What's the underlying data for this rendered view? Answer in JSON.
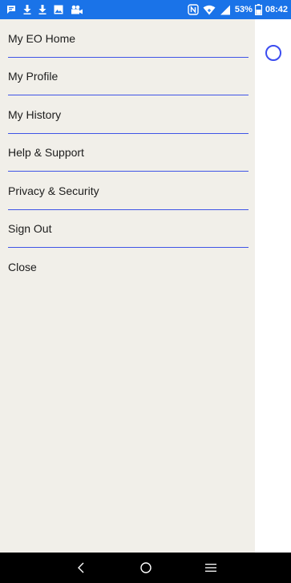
{
  "status_bar": {
    "left_icons": [
      "message-icon",
      "download-icon",
      "download-icon",
      "image-icon",
      "video-call-icon"
    ],
    "right_icons": [
      "nfc-icon",
      "wifi-icon",
      "signal-icon"
    ],
    "battery_percent": "53%",
    "time": "08:42",
    "background_color": "#1a73e8"
  },
  "drawer": {
    "background_color": "#f1efe9",
    "divider_color": "#3f54e6",
    "items": [
      {
        "label": "My EO Home"
      },
      {
        "label": "My Profile"
      },
      {
        "label": "My History"
      },
      {
        "label": "Help & Support"
      },
      {
        "label": "Privacy & Security"
      },
      {
        "label": "Sign Out"
      },
      {
        "label": "Close"
      }
    ]
  },
  "background": {
    "indicator_icon": "loading-ring-icon",
    "indicator_color": "#3b4cf0"
  },
  "nav_bar": {
    "buttons": [
      "back-icon",
      "home-icon",
      "menu-icon"
    ]
  }
}
